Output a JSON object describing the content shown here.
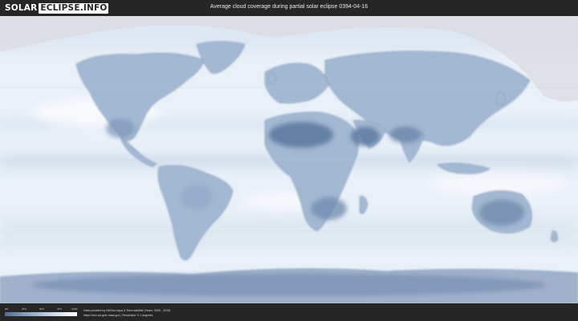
{
  "header": {
    "brand_part1": "SOLAR",
    "brand_part2": "ECLIPSE.INFO",
    "title": "Average cloud coverage during partial solar eclipse 0394-04-16"
  },
  "legend": {
    "ticks": [
      "0%",
      "25%",
      "50%",
      "75%",
      "100%"
    ],
    "colors": {
      "low": "#4f6d93",
      "mid": "#cdd9e8",
      "high": "#ffffff"
    }
  },
  "footer": {
    "credit_line1": "Data provided by NASAs Aqua & Terra satellite (Years: 2000 - 2019)",
    "credit_line2": "https://neo.sci.gsfc.nasa.gov  |  Resolution: 0.1 degrees"
  },
  "map": {
    "projection": "equirectangular world map",
    "colors": {
      "ocean_cloud": "#e9f0f8",
      "land": "#9db3cf",
      "desert": "#5d7aa0",
      "shadow_outside": "#d9dce0"
    }
  }
}
